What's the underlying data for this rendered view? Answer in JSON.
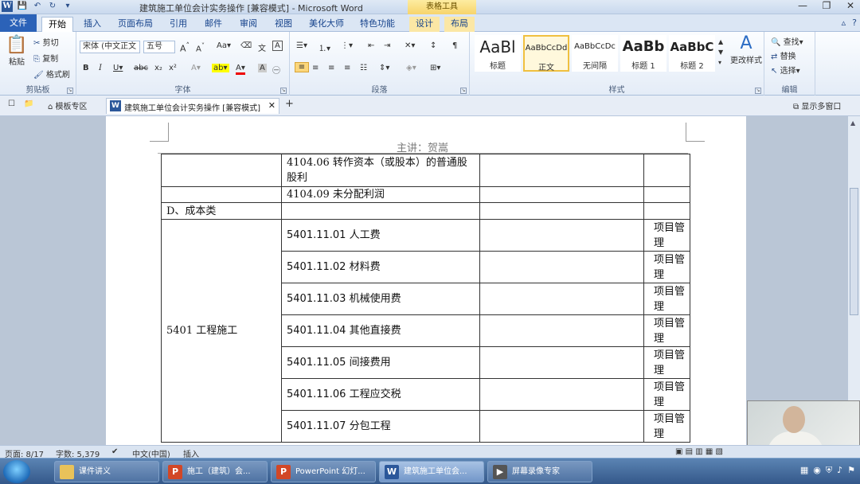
{
  "window": {
    "title": "建筑施工单位会计实务操作 [兼容模式] - Microsoft Word",
    "context_group": "表格工具"
  },
  "tabs": [
    {
      "label": "文件",
      "kind": "file"
    },
    {
      "label": "开始",
      "kind": "active"
    },
    {
      "label": "插入"
    },
    {
      "label": "页面布局"
    },
    {
      "label": "引用"
    },
    {
      "label": "邮件"
    },
    {
      "label": "审阅"
    },
    {
      "label": "视图"
    },
    {
      "label": "美化大师"
    },
    {
      "label": "特色功能"
    },
    {
      "label": "设计",
      "kind": "ctx"
    },
    {
      "label": "布局",
      "kind": "ctx"
    }
  ],
  "ribbon": {
    "clipboard": {
      "label": "剪贴板",
      "paste": "粘贴",
      "cut": "剪切",
      "copy": "复制",
      "format_painter": "格式刷"
    },
    "font": {
      "label": "字体",
      "font_name": "宋体 (中文正文",
      "font_size": "五号"
    },
    "paragraph": {
      "label": "段落"
    },
    "styles": {
      "label": "样式",
      "items": [
        {
          "sample": "AaBl",
          "name": "标题"
        },
        {
          "sample": "AaBbCcDd",
          "name": "正文",
          "selected": true
        },
        {
          "sample": "AaBbCcDc",
          "name": "无间隔"
        },
        {
          "sample": "AaBb",
          "name": "标题 1"
        },
        {
          "sample": "AaBbC",
          "name": "标题 2"
        }
      ],
      "change_styles": "更改样式"
    },
    "editing": {
      "label": "编辑",
      "find": "查找",
      "replace": "替换",
      "select": "选择"
    }
  },
  "docbar": {
    "template_zone": "模板专区",
    "doc_tab": "建筑施工单位会计实务操作 [兼容模式]",
    "multi_window": "显示多窗口"
  },
  "document": {
    "header": "主讲：贺嵩",
    "rows": [
      {
        "c1": "",
        "c2": "4104.06 转作资本（或股本）的普通股股利",
        "c3": "",
        "c4": ""
      },
      {
        "c1": "",
        "c2": "4104.09 未分配利润",
        "c3": "",
        "c4": ""
      },
      {
        "c1": "D、成本类",
        "c2": "",
        "c3": "",
        "c4": ""
      }
    ],
    "group_label": "5401 工程施工",
    "group_rows": [
      {
        "c2": "5401.11.01 人工费",
        "c4": "项目管理"
      },
      {
        "c2": "5401.11.02 材料费",
        "c4": "项目管理"
      },
      {
        "c2": "5401.11.03 机械使用费",
        "c4": "项目管理"
      },
      {
        "c2": "5401.11.04 其他直接费",
        "c4": "项目管理"
      },
      {
        "c2": "5401.11.05 间接费用",
        "c4": "项目管理"
      },
      {
        "c2": "5401.11.06 工程应交税",
        "c4": "项目管理"
      },
      {
        "c2": "5401.11.07 分包工程",
        "c4": "项目管理"
      }
    ]
  },
  "statusbar": {
    "page": "页面: 8/17",
    "words": "字数: 5,379",
    "lang": "中文(中国)",
    "mode": "插入"
  },
  "taskbar": [
    {
      "label": "课件讲义",
      "icon": "folder-icon",
      "color": "#e8c25a"
    },
    {
      "label": "施工（建筑）会...",
      "icon": "powerpoint-icon",
      "color": "#d24726"
    },
    {
      "label": "PowerPoint 幻灯...",
      "icon": "powerpoint-icon",
      "color": "#d24726"
    },
    {
      "label": "建筑施工单位会...",
      "icon": "word-icon",
      "color": "#2b579a",
      "active": true
    },
    {
      "label": "屏幕录像专家",
      "icon": "recorder-icon",
      "color": "#555555"
    }
  ]
}
